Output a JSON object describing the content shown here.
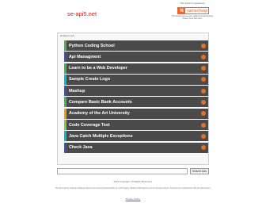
{
  "header": {
    "site_title": "se-api5.net",
    "promo_small": "This domain is registered at",
    "registrar_name": "namecheap",
    "promo_desc": "This domain was recently registered at Namecheap. Please check back later!"
  },
  "panel": {
    "related_label": "Related Links",
    "items": [
      {
        "label": "Python Coding School",
        "color": "#4caf50"
      },
      {
        "label": "Api Managment",
        "color": "#3f51b5"
      },
      {
        "label": "Learn to be a Web Developer",
        "color": "#4caf50"
      },
      {
        "label": "Sample Create Logo",
        "color": "#00bcd4"
      },
      {
        "label": "Mashup",
        "color": "#3f51b5"
      },
      {
        "label": "Compare Basic Bank Accounts",
        "color": "#4caf50"
      },
      {
        "label": "Academy of the Art University",
        "color": "#ff9800"
      },
      {
        "label": "Code Coverage Test",
        "color": "#8bc34a"
      },
      {
        "label": "Java Catch Multiple Exceptions",
        "color": "#00bcd4"
      },
      {
        "label": "Check Java",
        "color": "#3f51b5"
      }
    ]
  },
  "search": {
    "placeholder": "",
    "button_label": "Search Ads"
  },
  "footer": {
    "copyright": "2023 Copyright. All Rights Reserved.",
    "disclaimer": "The Sponsored Listings displayed above are served automatically by a third party. Neither Parkingcrew nor the domain owner maintain any relationship with the advertisers.",
    "privacy": "Privacy Policy"
  },
  "colors": {
    "item_bg": "#4a4a4a",
    "arrow": "#e36f2a",
    "title": "#c81e1e",
    "brand": "#f26522"
  }
}
